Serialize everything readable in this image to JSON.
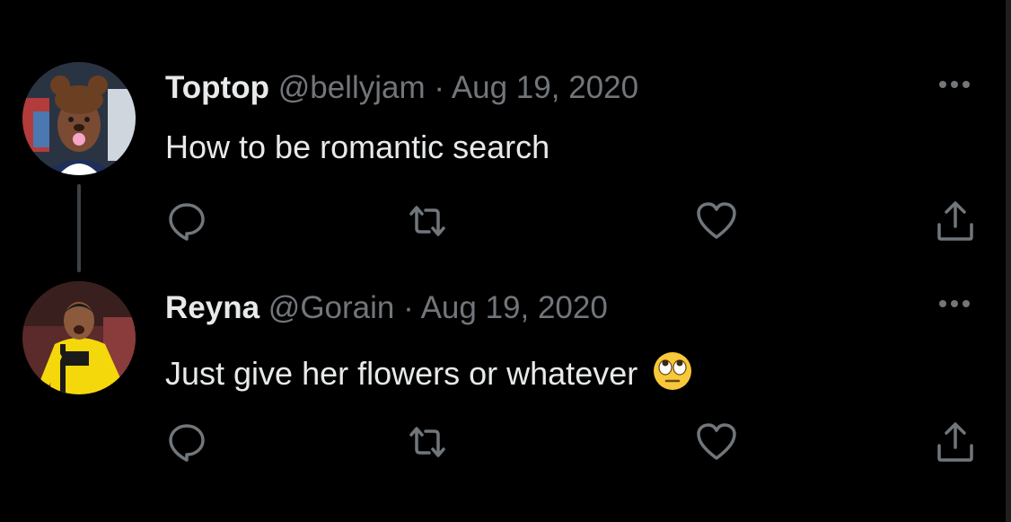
{
  "tweets": [
    {
      "display_name": "Toptop",
      "handle": "@bellyjam",
      "separator": "·",
      "date": "Aug 19, 2020",
      "text": "How to be romantic search"
    },
    {
      "display_name": "Reyna",
      "handle": "@Gorain",
      "separator": "·",
      "date": "Aug 19, 2020",
      "text": "Just give her flowers or whatever",
      "emoji": "face-with-rolling-eyes"
    }
  ],
  "icons": {
    "reply": "reply-icon",
    "retweet": "retweet-icon",
    "like": "heart-icon",
    "share": "share-icon",
    "more": "more-options-icon"
  },
  "colors": {
    "background": "#000000",
    "text_primary": "#e7e9ea",
    "text_secondary": "#71767b",
    "thread_line": "#3d4246"
  }
}
